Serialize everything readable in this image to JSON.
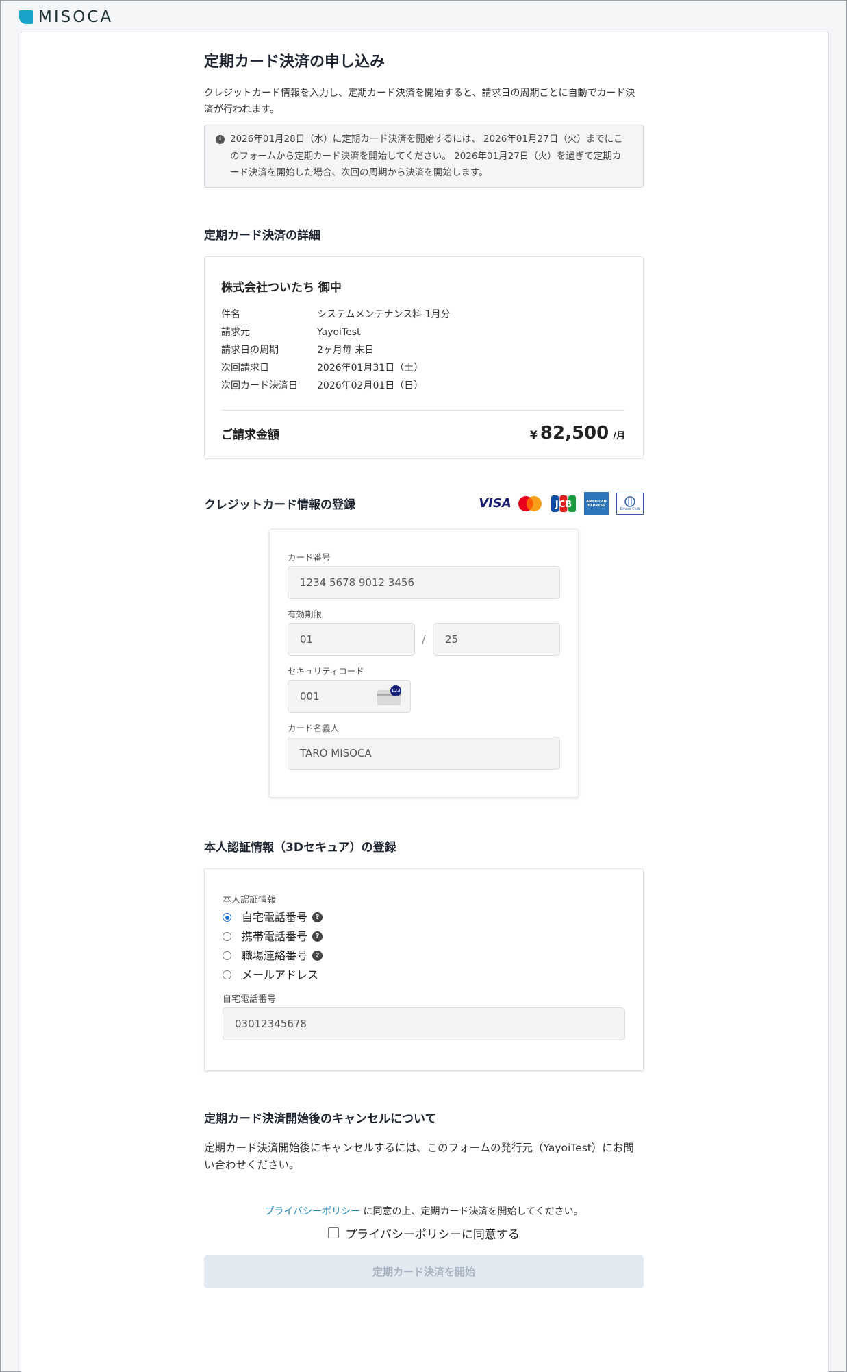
{
  "app": {
    "logo_text": "MISOCA"
  },
  "page": {
    "title": "定期カード決済の申し込み",
    "intro": "クレジットカード情報を入力し、定期カード決済を開始すると、請求日の周期ごとに自動でカード決済が行われます。",
    "notice": "2026年01月28日（水）に定期カード決済を開始するには、 2026年01月27日（火）までにこのフォームから定期カード決済を開始してください。 2026年01月27日（火）を過ぎて定期カード決済を開始した場合、次回の周期から決済を開始します。"
  },
  "details": {
    "section_title": "定期カード決済の詳細",
    "company": "株式会社ついたち 御中",
    "rows": [
      {
        "key": "件名",
        "value": "システムメンテナンス料 1月分"
      },
      {
        "key": "請求元",
        "value": "YayoiTest"
      },
      {
        "key": "請求日の周期",
        "value": "2ヶ月毎 末日"
      },
      {
        "key": "次回請求日",
        "value": "2026年01月31日（土）"
      },
      {
        "key": "次回カード決済日",
        "value": "2026年02月01日（日）"
      }
    ],
    "total_label": "ご請求金額",
    "total_currency": "¥",
    "total_amount": "82,500",
    "total_unit": "/月"
  },
  "credit_card": {
    "section_title": "クレジットカード情報の登録",
    "brands": [
      "visa-icon",
      "mastercard-icon",
      "jcb-icon",
      "amex-icon",
      "diners-icon"
    ],
    "brand_visa": "VISA",
    "brand_jcb": "JCB",
    "brand_amex": "AMERICAN EXPRESS",
    "brand_diners": "Diners Club",
    "number_label": "カード番号",
    "number_placeholder": "1234 5678 9012 3456",
    "expiry_label": "有効期限",
    "expiry_month_placeholder": "01",
    "expiry_sep": "/",
    "expiry_year_placeholder": "25",
    "cvc_label": "セキュリティコード",
    "cvc_placeholder": "001",
    "cvc_badge": "123",
    "name_label": "カード名義人",
    "name_placeholder": "TARO MISOCA"
  },
  "auth": {
    "section_title": "本人認証情報（3Dセキュア）の登録",
    "group_label": "本人認証情報",
    "options": [
      {
        "label": "自宅電話番号",
        "selected": true,
        "help": true
      },
      {
        "label": "携帯電話番号",
        "selected": false,
        "help": true
      },
      {
        "label": "職場連絡番号",
        "selected": false,
        "help": true
      },
      {
        "label": "メールアドレス",
        "selected": false,
        "help": false
      }
    ],
    "help_mark": "?",
    "field_label": "自宅電話番号",
    "field_placeholder": "03012345678"
  },
  "cancel": {
    "section_title": "定期カード決済開始後のキャンセルについて",
    "text": "定期カード決済開始後にキャンセルするには、このフォームの発行元（YayoiTest）にお問い合わせください。"
  },
  "consent": {
    "privacy_link": "プライバシーポリシー",
    "privacy_suffix": " に同意の上、定期カード決済を開始してください。",
    "checkbox_label": "プライバシーポリシーに同意する",
    "submit_label": "定期カード決済を開始"
  },
  "colors": {
    "accent": "#1aa3c8",
    "link": "#1a86b8",
    "radio_on": "#1a73e8",
    "submit_bg": "#e3e9f1"
  }
}
